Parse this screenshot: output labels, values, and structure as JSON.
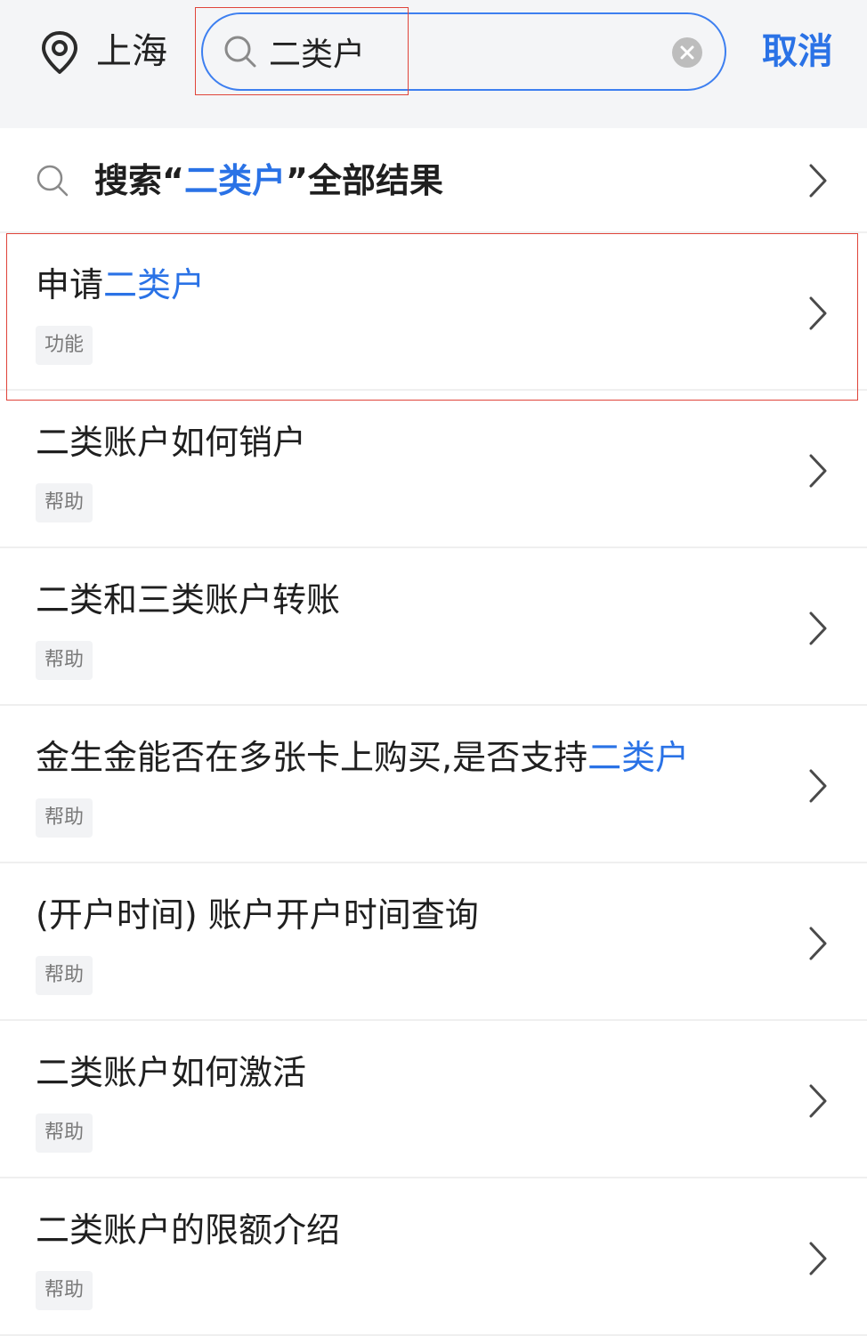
{
  "header": {
    "location_icon": "location-pin-icon",
    "city": "上海",
    "search": {
      "value": "二类户",
      "icon": "search-icon",
      "clear_icon": "clear-circle-icon"
    },
    "cancel_label": "取消"
  },
  "search_all": {
    "icon": "search-icon",
    "prefix": "搜索“",
    "keyword": "二类户",
    "suffix": "”全部结果"
  },
  "results": [
    {
      "title_plain": "申请",
      "title_highlight": "二类户",
      "tag": "功能"
    },
    {
      "title_plain": "二类账户如何销户",
      "title_highlight": "",
      "tag": "帮助"
    },
    {
      "title_plain": "二类和三类账户转账",
      "title_highlight": "",
      "tag": "帮助"
    },
    {
      "title_plain": "金生金能否在多张卡上购买,是否支持",
      "title_highlight": "二类户",
      "tag": "帮助"
    },
    {
      "title_plain": "(开户时间) 账户开户时间查询",
      "title_highlight": "",
      "tag": "帮助"
    },
    {
      "title_plain": "二类账户如何激活",
      "title_highlight": "",
      "tag": "帮助"
    },
    {
      "title_plain": "二类账户的限额介绍",
      "title_highlight": "",
      "tag": "帮助"
    }
  ],
  "colors": {
    "accent": "#2a72e6",
    "header_bg": "#f4f5f7",
    "annotation": "#e0443a"
  }
}
